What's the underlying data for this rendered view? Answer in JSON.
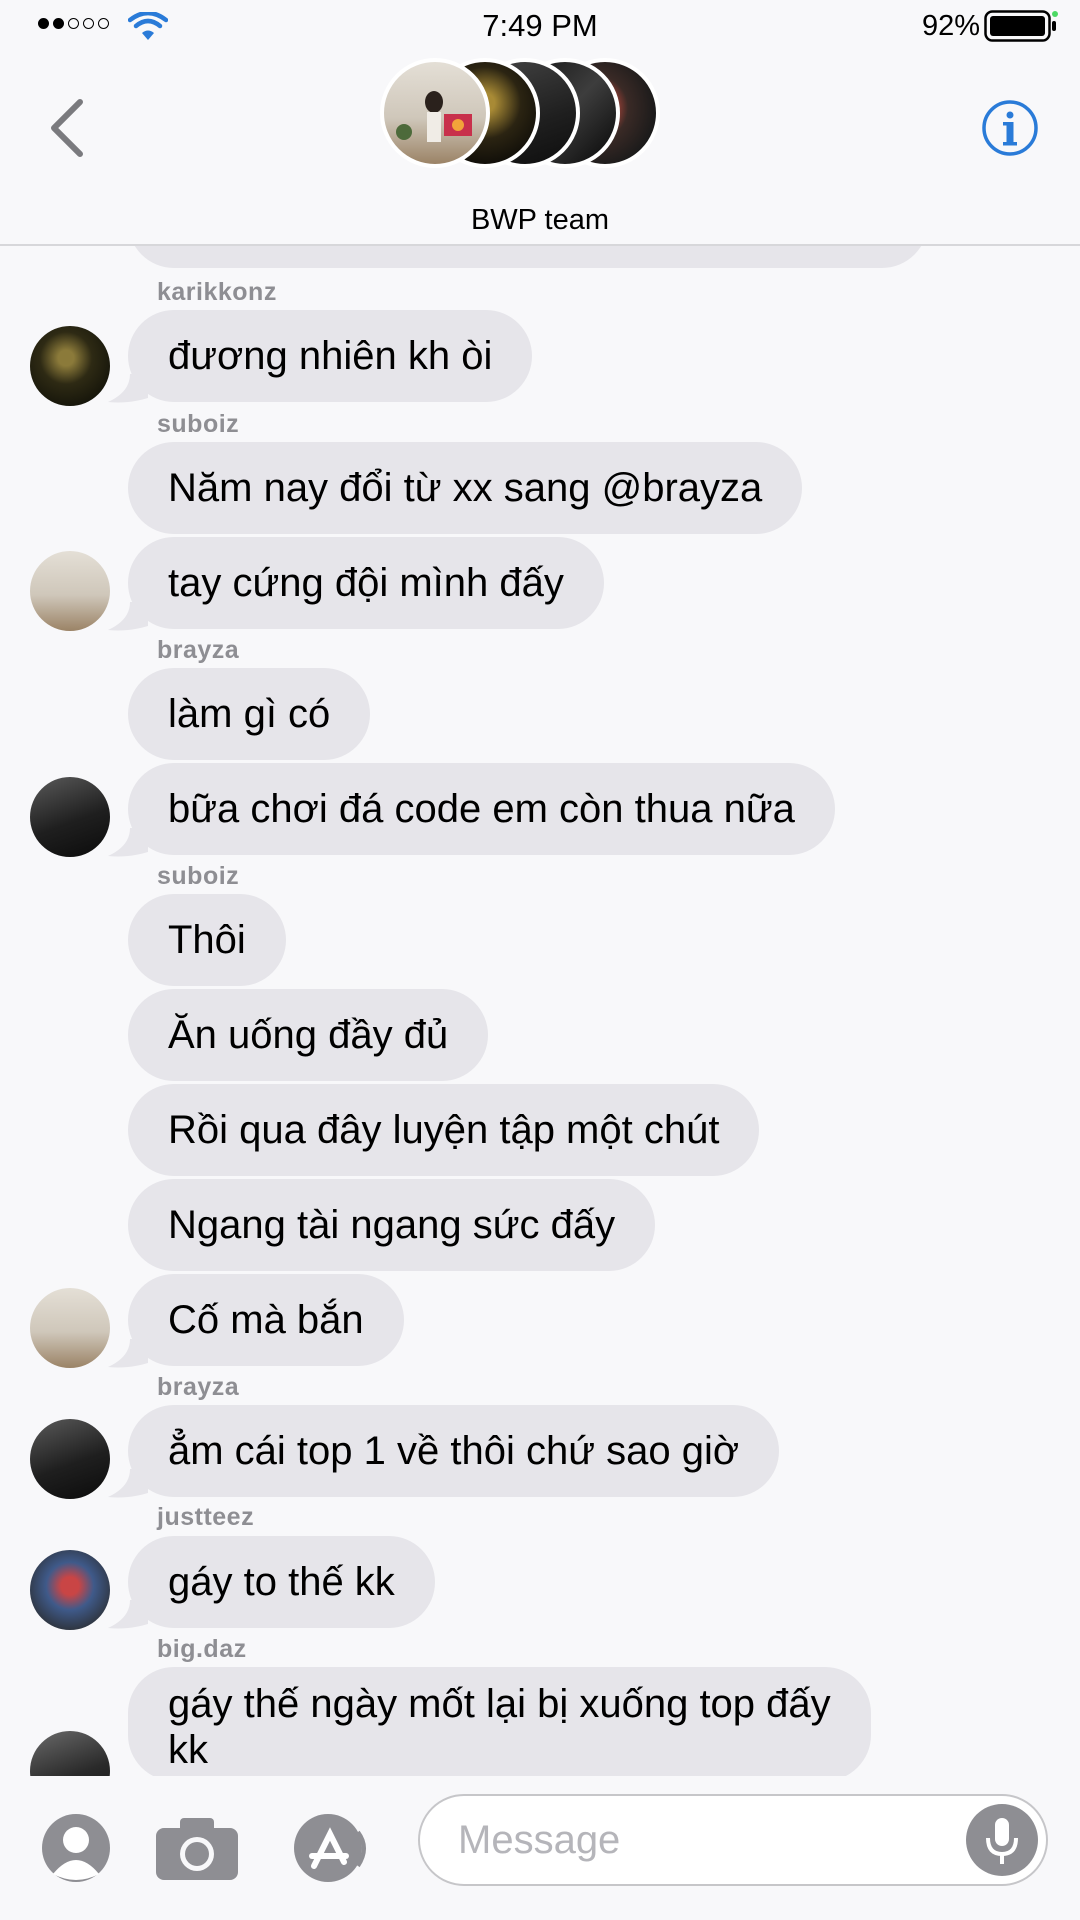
{
  "status_bar": {
    "time": "7:49 PM",
    "battery": "92%",
    "signal_bars_filled": 2,
    "signal_bars_total": 5
  },
  "header": {
    "group_name": "BWP team",
    "back_icon": "chevron-left-icon",
    "info_icon": "info-icon",
    "accent_color": "#2a7bd8"
  },
  "chat": {
    "bubble_color": "#e6e5ea",
    "sender_color": "#8e8e93",
    "senders": {
      "s1": "karikkonz",
      "s2": "suboiz",
      "s3": "brayza",
      "s4": "suboiz",
      "s5": "brayza",
      "s6": "justteez",
      "s7": "big.daz"
    },
    "messages": [
      "đương nhiên kh òi",
      "Năm nay đổi từ xx sang @brayza",
      "tay cứng đội mình đấy",
      "làm gì có",
      "bữa chơi đá code em còn thua nữa",
      "Thôi",
      "Ăn uống đầy đủ",
      "Rồi qua đây luyện tập một chút",
      "Ngang tài ngang sức đấy",
      "Cố mà bắn",
      "ẳm cái top 1 về thôi chứ sao giờ",
      "gáy to thế kk",
      "gáy thế ngày mốt lại bị xuống top đấy",
      "kk"
    ]
  },
  "input": {
    "placeholder": "Message",
    "icons": [
      "contacts-icon",
      "camera-icon",
      "app-store-icon",
      "microphone-icon"
    ]
  }
}
